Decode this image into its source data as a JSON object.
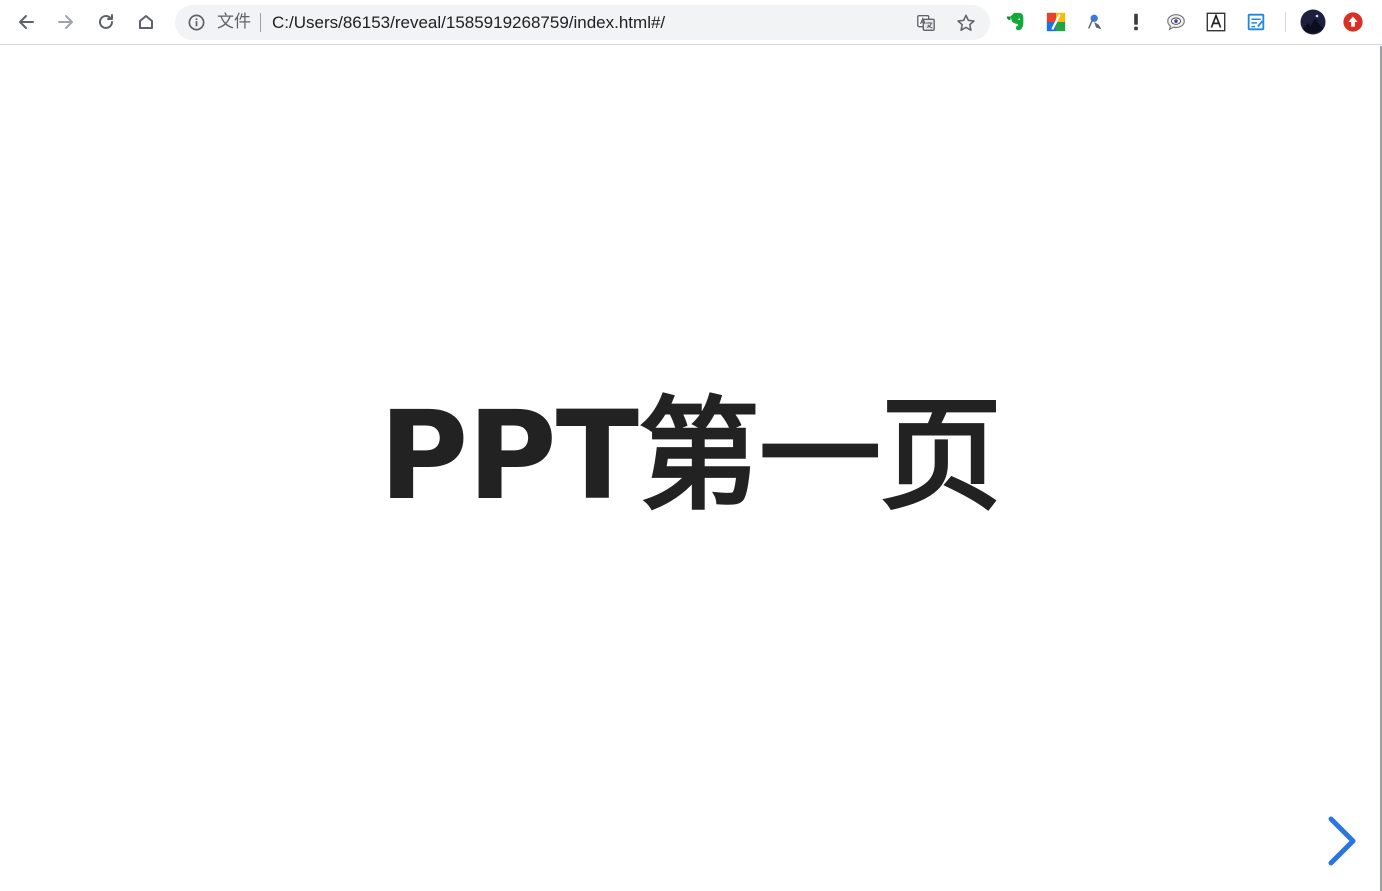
{
  "browser": {
    "omnibox": {
      "scheme_label": "文件",
      "url": "C:/Users/86153/reveal/1585919268759/index.html#/"
    },
    "nav": {
      "back_icon": "arrow-left-icon",
      "forward_icon": "arrow-right-icon",
      "reload_icon": "reload-icon",
      "home_icon": "home-icon"
    },
    "extensions": [
      "evernote-icon",
      "rainbow-extension-icon",
      "pin-extension-icon",
      "exclamation-icon",
      "eye-chat-icon",
      "font-a-icon",
      "note-edit-icon",
      "profile-avatar",
      "red-upgrade-icon"
    ]
  },
  "slide": {
    "title": "PPT第一页"
  },
  "controls": {
    "next_icon": "chevron-right-icon",
    "accent_color": "#2a76dd"
  }
}
